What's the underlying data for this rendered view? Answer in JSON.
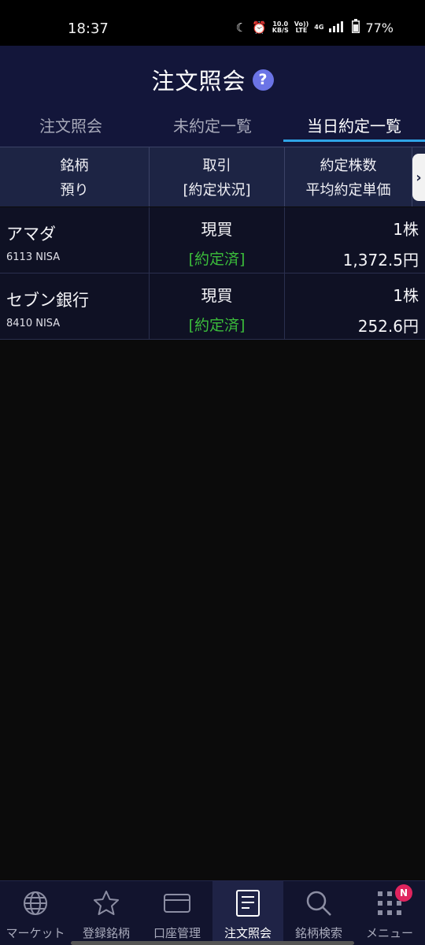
{
  "status_bar": {
    "time": "18:37",
    "net_speed": "10.0",
    "net_unit": "KB/S",
    "volte_top": "Vo))",
    "volte_bottom": "LTE",
    "network": "4G",
    "battery": "77%",
    "icons": [
      "moon-icon",
      "alarm-icon",
      "signal-icon",
      "battery-icon"
    ]
  },
  "header": {
    "title": "注文照会",
    "help_icon": "?"
  },
  "tabs": [
    {
      "label": "注文照会",
      "active": false
    },
    {
      "label": "未約定一覧",
      "active": false
    },
    {
      "label": "当日約定一覧",
      "active": true
    }
  ],
  "table": {
    "headers": {
      "col1_top": "銘柄",
      "col1_bottom": "預り",
      "col2_top": "取引",
      "col2_bottom": "[約定状況]",
      "col3_top": "約定株数",
      "col3_bottom": "平均約定単価"
    },
    "scroll_arrow": "›",
    "rows": [
      {
        "name": "アマダ",
        "code": "6113 NISA",
        "trade": "現買",
        "status": "[約定済]",
        "quantity": "1株",
        "price": "1,372.5円"
      },
      {
        "name": "セブン銀行",
        "code": "8410 NISA",
        "trade": "現買",
        "status": "[約定済]",
        "quantity": "1株",
        "price": "252.6円"
      }
    ]
  },
  "bottom_nav": [
    {
      "label": "マーケット",
      "icon": "globe-icon"
    },
    {
      "label": "登録銘柄",
      "icon": "star-icon"
    },
    {
      "label": "口座管理",
      "icon": "card-icon"
    },
    {
      "label": "注文照会",
      "icon": "document-icon",
      "active": true
    },
    {
      "label": "銘柄検索",
      "icon": "search-icon"
    },
    {
      "label": "メニュー",
      "icon": "grid-icon",
      "badge": "N"
    }
  ],
  "colors": {
    "header_bg": "#13163a",
    "active_tab_underline": "#2fa4e6",
    "status_green": "#3bbd3b",
    "help_icon": "#6b74e6",
    "badge": "#e0245e"
  }
}
